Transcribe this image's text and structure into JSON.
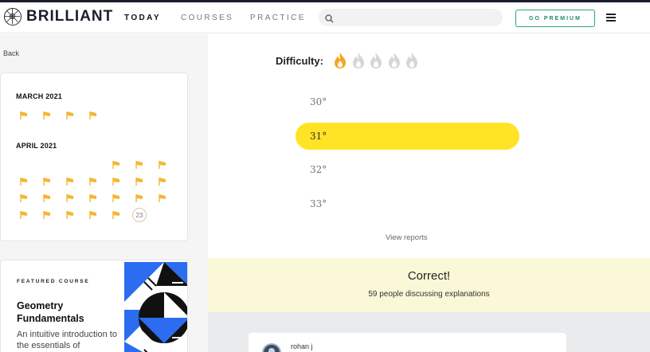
{
  "header": {
    "logo_text": "BRILLIANT",
    "nav": [
      "TODAY",
      "COURSES",
      "PRACTICE"
    ],
    "active_nav": "TODAY",
    "search_placeholder": "",
    "premium_label": "GO PREMIUM",
    "accent_color": "#2aa37a"
  },
  "sidebar": {
    "back_label": "Back",
    "calendar": {
      "months": [
        {
          "label": "MARCH 2021",
          "completed_days": 4
        },
        {
          "label": "APRIL 2021",
          "completed_days": 22,
          "current_day": "23"
        }
      ],
      "flag_color": "#f5b634"
    },
    "featured": {
      "label": "FEATURED COURSE",
      "title": "Geometry Fundamentals",
      "description": "An intuitive introduction to the essentials of"
    }
  },
  "main": {
    "difficulty_label": "Difficulty:",
    "difficulty_level": 1,
    "difficulty_max": 5,
    "options": [
      "30°",
      "31°",
      "32°",
      "33°"
    ],
    "selected_option": "31°",
    "selected_color": "#ffe426",
    "view_reports": "View reports",
    "result": {
      "title": "Correct!",
      "discussion": "59 people discussing explanations"
    },
    "comment": {
      "user": "rohan j"
    }
  }
}
